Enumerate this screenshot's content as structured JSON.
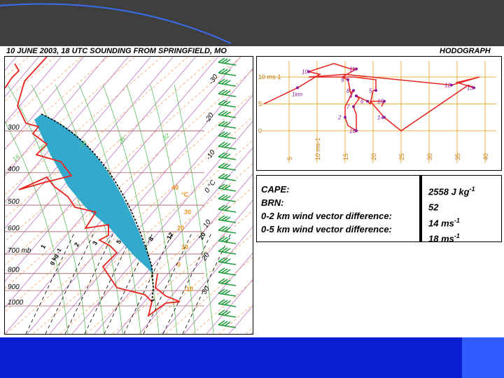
{
  "header": {
    "left_title": "10 JUNE 2003, 18 UTC SOUNDING FROM SPRINGFIELD, MO",
    "right_title": "HODOGRAPH"
  },
  "colors": {
    "top_band": "#3f3f3f",
    "bottom_band": "#0b1fd1",
    "temperature_profile": "#e8231e",
    "parcel_path": "#000000",
    "cape_fill": "#33aacc",
    "isotherms": "#f4a46e",
    "dry_adiabats": "#b05ab6",
    "moist_adiabats": "#5cbf5c",
    "mixing_ratio": "#000000",
    "wind_barbs": "#1f9b3b",
    "hodograph_grid": "#e8b04a",
    "hodograph_line": "#e8231e",
    "hodograph_points": "#8b1a9c"
  },
  "chart_data": [
    {
      "type": "line",
      "name": "Skew-T log-P sounding",
      "pressure_labels": [
        "300",
        "400",
        "500",
        "600",
        "700 mb",
        "800",
        "900",
        "1000"
      ],
      "pressure_levels": [
        300,
        400,
        500,
        600,
        700,
        800,
        900,
        1000
      ],
      "isotherm_labels": [
        "-30",
        "-20",
        "-10",
        "0 °C",
        "10",
        "20",
        "30"
      ],
      "isotherm_values": [
        -30,
        -20,
        -10,
        0,
        10,
        20,
        30
      ],
      "theta_e_labels": [
        "16",
        "20",
        "24",
        "28",
        "32"
      ],
      "moist_temp_labels": [
        "40",
        "°C",
        "30",
        "20",
        "10",
        "0",
        "-10"
      ],
      "mixing_ratio_labels": [
        "1",
        "2",
        "3",
        "5",
        "8",
        "12",
        "20"
      ],
      "mixing_ratio_unit": "g kg",
      "mixing_ratio_unit_exp": "-1",
      "cape_region": "shaded area between parcel path and temperature profile"
    },
    {
      "type": "line",
      "name": "Hodograph",
      "x_tick_labels": [
        "5",
        "10 ms-1",
        "15",
        "20",
        "25",
        "30",
        "35",
        "40"
      ],
      "x_ticks": [
        5,
        10,
        15,
        20,
        25,
        30,
        35,
        40
      ],
      "y_tick_labels": [
        "0",
        "5",
        "10 ms-1"
      ],
      "y_ticks": [
        0,
        5,
        10
      ],
      "xlim": [
        0,
        42
      ],
      "ylim": [
        -6,
        13
      ],
      "hodograph_trace": [
        {
          "label": "",
          "u": 0.5,
          "v": 5
        },
        {
          "label": "1km",
          "u": 6.5,
          "v": 8
        },
        {
          "label": "",
          "u": 10.5,
          "v": 10.5
        },
        {
          "label": "10",
          "u": 8.5,
          "v": 11
        },
        {
          "label": "",
          "u": 13,
          "v": 12.5
        },
        {
          "label": "",
          "u": 16,
          "v": 11.5
        },
        {
          "label": "11",
          "u": 17,
          "v": 11.5
        },
        {
          "label": "",
          "u": 14.5,
          "v": 10
        },
        {
          "label": "9",
          "u": 15.5,
          "v": 9.5
        },
        {
          "label": "",
          "u": 16,
          "v": 7
        },
        {
          "label": "8",
          "u": 16.5,
          "v": 7.5
        },
        {
          "label": "",
          "u": 15,
          "v": 4.5
        },
        {
          "label": "2",
          "u": 15,
          "v": 2.5
        },
        {
          "label": "",
          "u": 15.5,
          "v": 1
        },
        {
          "label": "16",
          "u": 17,
          "v": 0
        },
        {
          "label": "",
          "u": 17,
          "v": 3
        },
        {
          "label": "7",
          "u": 16.5,
          "v": 4.5
        },
        {
          "label": "",
          "u": 17.5,
          "v": 6
        },
        {
          "label": "4",
          "u": 17,
          "v": 6.5
        },
        {
          "label": "",
          "u": 18,
          "v": 6
        },
        {
          "label": "6",
          "u": 19,
          "v": 5.5
        },
        {
          "label": "",
          "u": 19.5,
          "v": 5
        },
        {
          "label": "",
          "u": 20,
          "v": 7.5
        },
        {
          "label": "5",
          "u": 20.5,
          "v": 7.5
        },
        {
          "label": "",
          "u": 20.5,
          "v": 9.5
        },
        {
          "label": "",
          "u": 16.5,
          "v": 10
        },
        {
          "label": "",
          "u": 8.5,
          "v": 10
        },
        {
          "label": "",
          "u": 15,
          "v": 10.5
        },
        {
          "label": "12",
          "u": 34,
          "v": 8.5
        },
        {
          "label": "",
          "u": 39,
          "v": 10
        },
        {
          "label": "",
          "u": 35,
          "v": 9
        },
        {
          "label": "13",
          "u": 38,
          "v": 8
        },
        {
          "label": "",
          "u": 37,
          "v": 8.5
        },
        {
          "label": "",
          "u": 25,
          "v": 0
        },
        {
          "label": "14",
          "u": 22,
          "v": 2.5
        },
        {
          "label": "",
          "u": 19.5,
          "v": 5.5
        },
        {
          "label": "15",
          "u": 22,
          "v": 5.5
        },
        {
          "label": "",
          "u": 21.5,
          "v": 4.5
        }
      ],
      "labelled_points": [
        "1km",
        "2",
        "3",
        "4",
        "5",
        "6",
        "7",
        "8",
        "9",
        "10",
        "11",
        "12",
        "13",
        "14",
        "15",
        "16"
      ]
    }
  ],
  "stats": {
    "rows": [
      {
        "label": "CAPE:",
        "value": "2558 J kg",
        "value_exp": "-1"
      },
      {
        "label": "BRN:",
        "value": "52",
        "value_exp": ""
      },
      {
        "label": "0-2 km wind vector difference:",
        "value": "14 ms",
        "value_exp": "-1"
      },
      {
        "label": "0-5 km wind vector difference:",
        "value": "18 ms",
        "value_exp": "-1"
      }
    ]
  }
}
